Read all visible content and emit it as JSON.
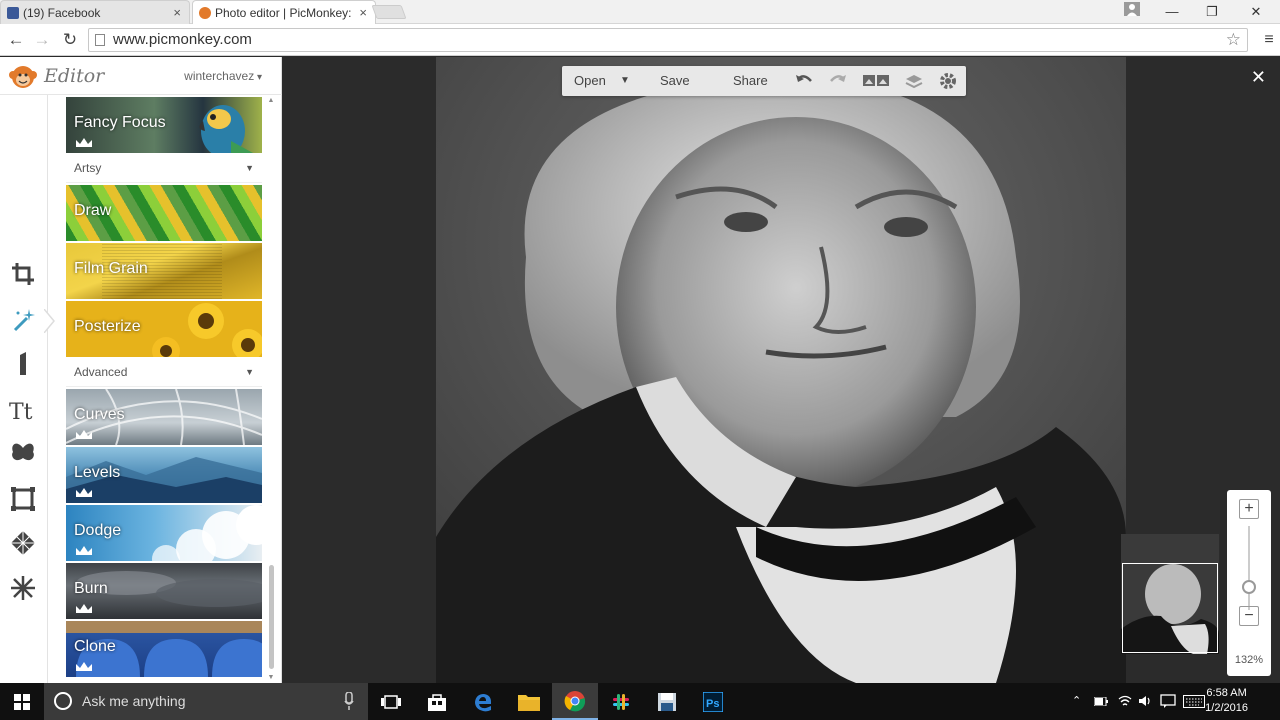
{
  "browser": {
    "tabs": [
      {
        "title": "(19) Facebook",
        "active": false
      },
      {
        "title": "Photo editor | PicMonkey:",
        "active": true
      }
    ],
    "url": "www.picmonkey.com"
  },
  "editor": {
    "app_title": "Editor",
    "user": "winterchavez"
  },
  "effects": {
    "tiles_top": [
      {
        "label": "Fancy Focus",
        "premium": true
      }
    ],
    "section_artsy": "Artsy",
    "tiles_artsy": [
      {
        "label": "Draw",
        "premium": false
      },
      {
        "label": "Film Grain",
        "premium": false
      },
      {
        "label": "Posterize",
        "premium": false
      }
    ],
    "section_advanced": "Advanced",
    "tiles_advanced": [
      {
        "label": "Curves",
        "premium": true
      },
      {
        "label": "Levels",
        "premium": true
      },
      {
        "label": "Dodge",
        "premium": true
      },
      {
        "label": "Burn",
        "premium": true
      },
      {
        "label": "Clone",
        "premium": true
      }
    ]
  },
  "toolbar": {
    "open": "Open",
    "save": "Save",
    "share": "Share"
  },
  "zoom": {
    "level": "132%",
    "plus": "+",
    "minus": "−"
  },
  "taskbar": {
    "search_placeholder": "Ask me anything",
    "time": "6:58 AM",
    "date": "1/2/2016"
  },
  "colors": {
    "accent": "#3e9bbf",
    "taskbar": "#101010",
    "canvas_bg": "#2b2b2b"
  }
}
